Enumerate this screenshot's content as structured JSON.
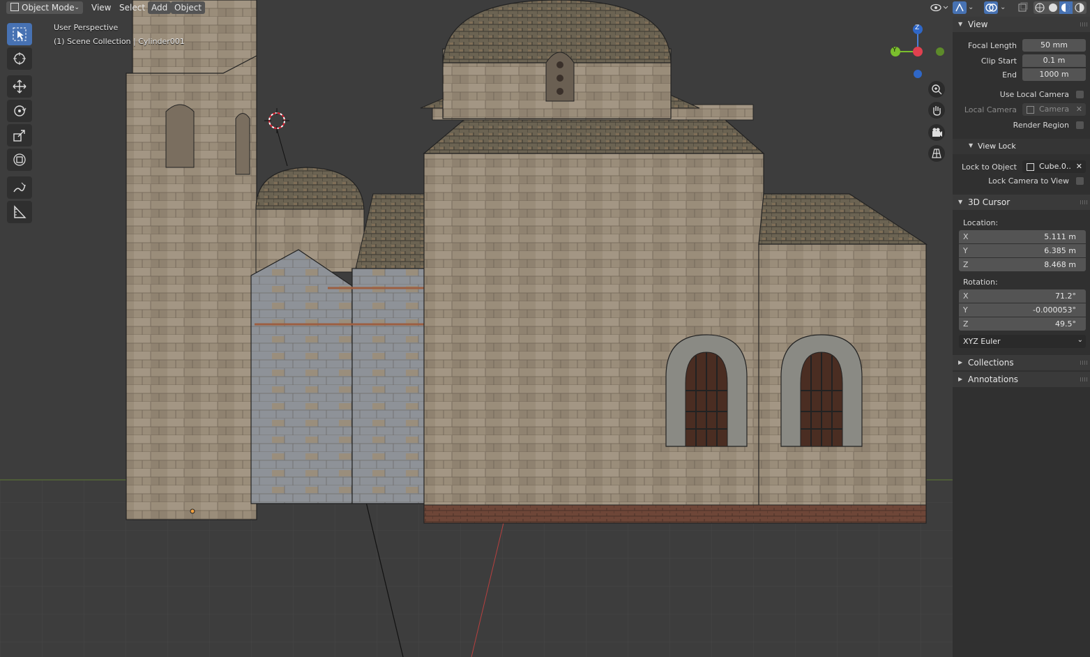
{
  "header": {
    "mode_label": "Object Mode",
    "menus": [
      "View",
      "Select",
      "Add",
      "Object"
    ]
  },
  "viewport": {
    "perspective_label": "User Perspective",
    "collection_label": "(1) Scene Collection | Cylinder001",
    "gizmo": {
      "z": "Z",
      "y": "Y"
    }
  },
  "toolbar": {
    "tools": [
      "select-box",
      "cursor",
      "move",
      "rotate",
      "scale",
      "transform",
      "annotate",
      "measure"
    ]
  },
  "navigation": {
    "icons": [
      "zoom-icon",
      "hand-pan-icon",
      "camera-icon",
      "grid-ortho-icon"
    ]
  },
  "sidebar": {
    "view": {
      "title": "View",
      "focal_length_label": "Focal Length",
      "focal_length": "50 mm",
      "clip_start_label": "Clip Start",
      "clip_start": "0.1 m",
      "end_label": "End",
      "end": "1000 m",
      "use_local_camera_label": "Use Local Camera",
      "local_camera_label": "Local Camera",
      "local_camera_value": "Camera",
      "render_region_label": "Render Region"
    },
    "view_lock": {
      "title": "View Lock",
      "lock_to_object_label": "Lock to Object",
      "lock_to_object_value": "Cube.0..",
      "lock_camera_label": "Lock Camera to View"
    },
    "cursor": {
      "title": "3D Cursor",
      "location_label": "Location:",
      "location": [
        {
          "axis": "X",
          "value": "5.111 m"
        },
        {
          "axis": "Y",
          "value": "6.385 m"
        },
        {
          "axis": "Z",
          "value": "8.468 m"
        }
      ],
      "rotation_label": "Rotation:",
      "rotation": [
        {
          "axis": "X",
          "value": "71.2°"
        },
        {
          "axis": "Y",
          "value": "-0.000053°"
        },
        {
          "axis": "Z",
          "value": "49.5°"
        }
      ],
      "rotation_mode": "XYZ Euler"
    },
    "collections_title": "Collections",
    "annotations_title": "Annotations"
  },
  "colors": {
    "accent": "#4772b3",
    "background": "#3d3d3d",
    "panel": "#303030"
  }
}
